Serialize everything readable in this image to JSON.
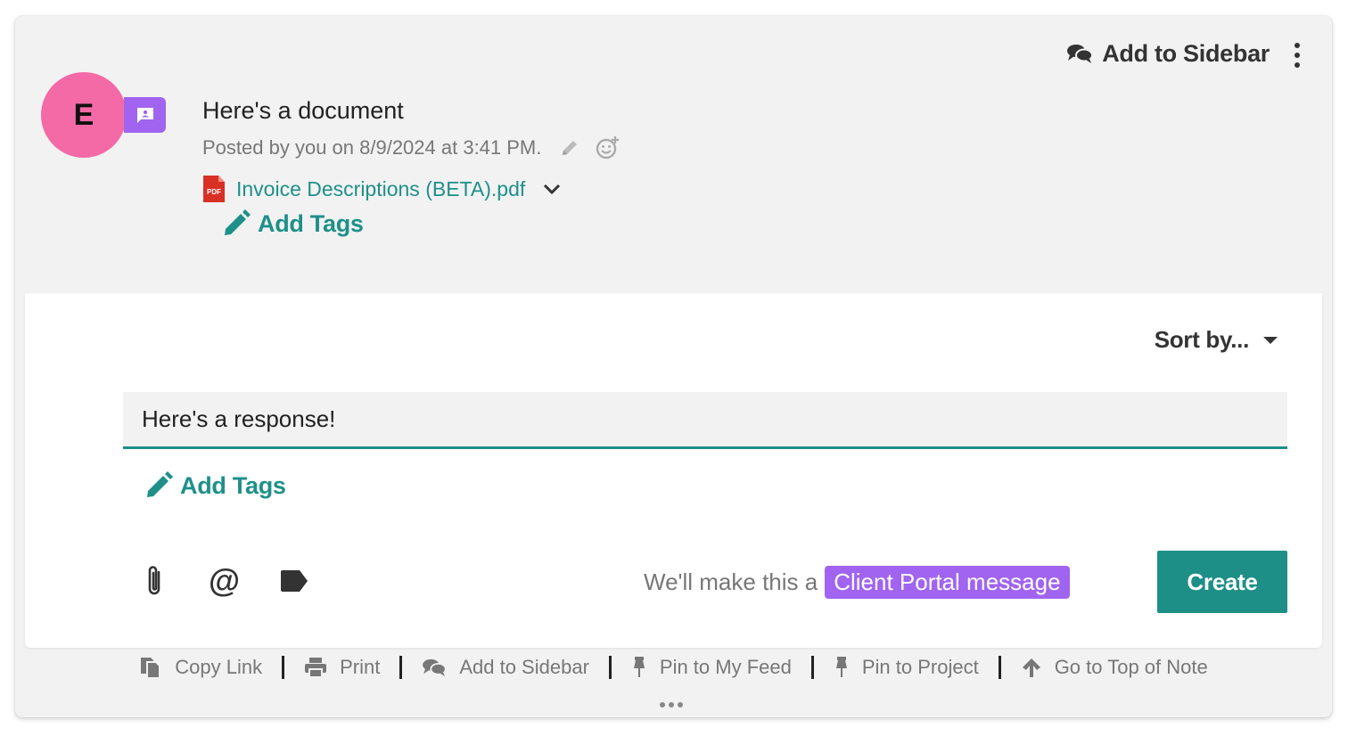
{
  "header": {
    "add_to_sidebar_label": "Add to Sidebar",
    "more_icon": "kebab-vertical-icon"
  },
  "post": {
    "avatar_initial": "E",
    "avatar_color": "#f36aa6",
    "badge_color": "#a064f0",
    "title": "Here's a document",
    "meta": "Posted by you on 8/9/2024 at 3:41 PM.",
    "attachment_name": "Invoice Descriptions (BETA).pdf",
    "attachment_icon_text": "PDF",
    "add_tags_label": "Add Tags"
  },
  "reply": {
    "sort_label": "Sort by...",
    "input_value": "Here's a response!",
    "add_tags_label": "Add Tags",
    "portal_prefix": "We'll make this a",
    "portal_badge": "Client Portal message",
    "create_label": "Create"
  },
  "footer": {
    "copy_link": "Copy Link",
    "print": "Print",
    "add_to_sidebar": "Add to Sidebar",
    "pin_to_feed": "Pin to My Feed",
    "pin_to_project": "Pin to Project",
    "go_to_top": "Go to Top of Note"
  },
  "colors": {
    "accent": "#1e9089",
    "purple": "#a064f0",
    "card_bg": "#f2f2f2"
  }
}
